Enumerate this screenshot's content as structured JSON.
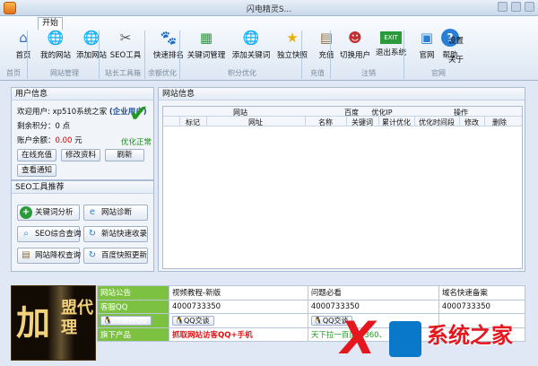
{
  "window": {
    "title": "闪电精灵S..."
  },
  "ribbon": {
    "tab": "开始",
    "buttons": [
      {
        "label": "首页",
        "icon": "home-icon",
        "glyph": "⌂",
        "color": "#3a6fc2"
      },
      {
        "label": "我的网站",
        "icon": "my-site-icon",
        "glyph": "🌐",
        "color": "#2a7fd4"
      },
      {
        "label": "添加网站",
        "icon": "add-site-icon",
        "glyph": "🌐",
        "color": "#2a9a3a"
      },
      {
        "label": "SEO工具",
        "icon": "tools-icon",
        "glyph": "✂",
        "color": "#555555"
      },
      {
        "label": "快速排名",
        "icon": "baidu-icon",
        "glyph": "🐾",
        "color": "#2a5fd4"
      },
      {
        "label": "关键词管理",
        "icon": "keyword-manage-icon",
        "glyph": "▦",
        "color": "#2a9a3a"
      },
      {
        "label": "添加关键词",
        "icon": "add-keyword-icon",
        "glyph": "🌐",
        "color": "#2a9a3a"
      },
      {
        "label": "独立快照",
        "icon": "star-icon",
        "glyph": "★",
        "color": "#e8b000"
      },
      {
        "label": "充值",
        "icon": "recharge-icon",
        "glyph": "▤",
        "color": "#8a6a3a"
      },
      {
        "label": "切换用户",
        "icon": "switch-user-icon",
        "glyph": "☻",
        "color": "#c03030"
      },
      {
        "label": "退出系统",
        "icon": "exit-icon",
        "glyph": "EXIT",
        "color": "#ffffff"
      },
      {
        "label": "官网",
        "icon": "website-icon",
        "glyph": "▣",
        "color": "#2a7fd4"
      },
      {
        "label": "帮助",
        "icon": "help-icon",
        "glyph": "?",
        "color": "#ffffff"
      }
    ],
    "side_links": [
      "设置",
      "关于"
    ],
    "groups": [
      "首页",
      "网站管理",
      "站长工具箱",
      "余额优化",
      "积分优化",
      "充值",
      "注销",
      "官网"
    ]
  },
  "user_panel": {
    "title": "用户信息",
    "welcome_prefix": "欢迎用户: xp510系统之家",
    "user_type": "(企业用户)",
    "points_label": "剩余积分：",
    "points_value": "0 点",
    "balance_label": "账户余额：",
    "balance_value": "0.00",
    "balance_unit": "元",
    "status": "优化正常",
    "buttons": [
      "在线充值",
      "修改资料",
      "刷新",
      "查看通知"
    ]
  },
  "seo_panel": {
    "title": "SEO工具推荐",
    "tools": [
      {
        "label": "关键词分析",
        "icon": "plus-circle-icon",
        "glyph": "+",
        "color": "#2a9a3a"
      },
      {
        "label": "网站诊断",
        "icon": "ie-icon",
        "glyph": "e",
        "color": "#2a7fd4"
      },
      {
        "label": "SEO综合查询",
        "icon": "magnifier-icon",
        "glyph": "⌕",
        "color": "#2a7fd4"
      },
      {
        "label": "新站快速收录",
        "icon": "refresh-icon",
        "glyph": "↻",
        "color": "#2a7fd4"
      },
      {
        "label": "网站降权查询",
        "icon": "document-icon",
        "glyph": "▤",
        "color": "#8a6a3a"
      },
      {
        "label": "百度快照更新",
        "icon": "refresh-icon",
        "glyph": "↻",
        "color": "#2a7fd4"
      }
    ]
  },
  "site_panel": {
    "title": "网站信息",
    "group_headers": [
      "网站",
      "百度",
      "优化IP",
      "操作"
    ],
    "columns": [
      "标记",
      "网址",
      "名称",
      "关键词",
      "累计优化",
      "优化时间段",
      "修改",
      "删除"
    ]
  },
  "promo_image": {
    "text_big": "加",
    "text_side": "盟代理"
  },
  "info_table": [
    [
      "网站公告",
      "视频教程-新版",
      "问题必看",
      "域名快速备案"
    ],
    [
      "客服QQ",
      "4000733350",
      "4000733350",
      "4000733350"
    ],
    [
      "01统计QQ",
      "QQ交谈",
      "QQ交谈",
      ""
    ],
    [
      "旗下产品",
      "抓取网站访客QQ+手机",
      "天下拉一百度、360、",
      ""
    ]
  ],
  "watermark": {
    "xp": "X",
    "site_name": "系统之家"
  }
}
